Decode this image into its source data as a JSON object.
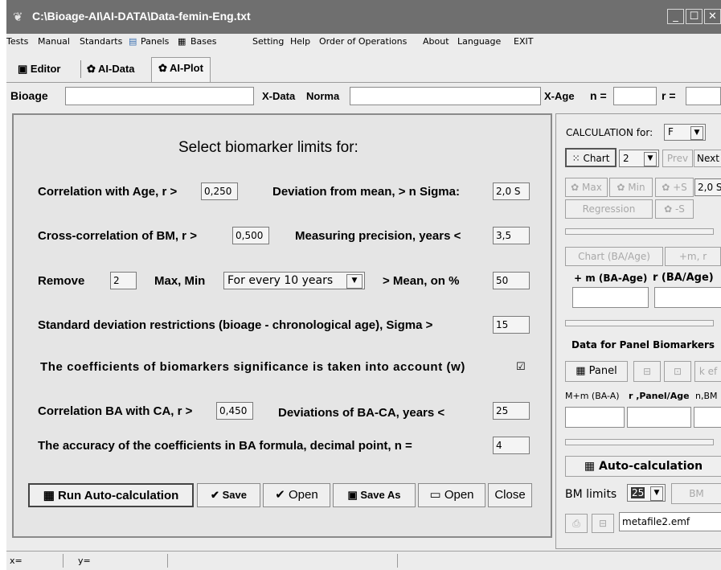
{
  "window": {
    "title": "C:\\Bioage-AI\\AI-DATA\\Data-femin-Eng.txt"
  },
  "menu": [
    "Tests",
    "Manual",
    "Standarts",
    "Panels",
    "Bases",
    "Setting",
    "Help",
    "Order of Operations",
    "About",
    "Language",
    "EXIT"
  ],
  "tabs": [
    "Editor",
    "AI-Data",
    "AI-Plot"
  ],
  "fields": {
    "bioage": "Bioage",
    "xdata": "X-Data",
    "norma": "Norma",
    "xage": "X-Age",
    "n": "n =",
    "r": "r ="
  },
  "main": {
    "heading": "Select biomarker limits for:",
    "corr_age_label": "Correlation with Age, r >",
    "corr_age_value": "0,250",
    "dev_mean_label": "Deviation from mean, > n Sigma:",
    "dev_mean_value": "2,0 S",
    "cross_label": "Cross-correlation of BM, r >",
    "cross_value": "0,500",
    "precision_label": "Measuring precision, years <",
    "precision_value": "3,5",
    "remove_label": "Remove",
    "remove_value": "2",
    "maxmin_label": "Max, Min",
    "every_option": "For every 10 years",
    "mean_label": "> Mean, on %",
    "mean_value": "50",
    "sd_label": "Standard deviation restrictions (bioage - chronological age), Sigma >",
    "sd_value": "15",
    "coef_label": "The coefficients of biomarkers significance is taken into account (w)",
    "coef_checked": true,
    "corr_ba_label": "Correlation BA with CA, r >",
    "corr_ba_value": "0,450",
    "dev_ba_label": "Deviations of BA-CA, years <",
    "dev_ba_value": "25",
    "accuracy_label": "The accuracy of the coefficients in BA formula, decimal point,   n  =",
    "accuracy_value": "4"
  },
  "buttons": {
    "run": "Run Auto-calculation",
    "save": "Save",
    "open1": "Open",
    "saveas": "Save As",
    "open2": "Open",
    "close": "Close"
  },
  "side": {
    "calc_label": "CALCULATION for:",
    "calc_value": "F",
    "chart": "Chart",
    "chart_num": "2",
    "prev": "Prev",
    "next": "Next",
    "max": "Max",
    "min": "Min",
    "plus_s": "+S",
    "sigma_value": "2,0 S",
    "regression": "Regression",
    "minus_s": "-S",
    "chart_ba": "Chart (BA/Age)",
    "plus_mr": "+m, r",
    "m_ba_label": "+ m (BA-Age)",
    "r_ba_label": "r (BA/Age)",
    "panel_bm_label": "Data for Panel Biomarkers",
    "panel": "Panel",
    "kef": "k ef",
    "mba_label": "M+m (BA-A)",
    "rpanel_label": "r ,Panel/Age",
    "nbm_label": "n,BM",
    "autocalc": "Auto-calculation",
    "bm_limits": "BM limits",
    "bm_limits_value": "25",
    "bm": "BM",
    "metafile": "metafile2.emf"
  },
  "status": {
    "x": "x=",
    "y": "y="
  }
}
